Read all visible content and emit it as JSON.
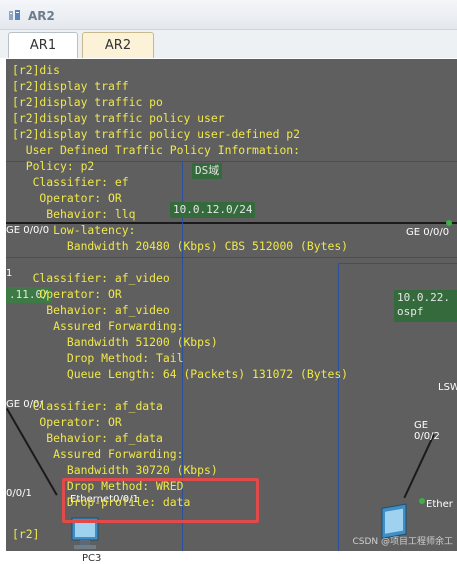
{
  "window": {
    "title": "AR2",
    "icon": "router-icon"
  },
  "tabs": [
    {
      "label": "AR1",
      "active": false
    },
    {
      "label": "AR2",
      "active": true
    }
  ],
  "terminal": {
    "text_color": "#f0e84a",
    "background": "#5f5f5f",
    "lines": [
      "[r2]dis",
      "[r2]display traff",
      "[r2]display traffic po",
      "[r2]display traffic policy user",
      "[r2]display traffic policy user-defined p2",
      "  User Defined Traffic Policy Information:",
      "  Policy: p2",
      "   Classifier: ef",
      "    Operator: OR",
      "     Behavior: llq",
      "      Low-latency:",
      "        Bandwidth 20480 (Kbps) CBS 512000 (Bytes)",
      "",
      "   Classifier: af_video",
      "    Operator: OR",
      "     Behavior: af_video",
      "      Assured Forwarding:",
      "        Bandwidth 51200 (Kbps)",
      "        Drop Method: Tail",
      "        Queue Length: 64 (Packets) 131072 (Bytes)",
      "",
      "   Classifier: af_data",
      "    Operator: OR",
      "     Behavior: af_data",
      "      Assured Forwarding:",
      "        Bandwidth 30720 (Kbps)",
      "        Drop Method: WRED",
      "        Drop-profile: data",
      "",
      "[r2]"
    ]
  },
  "background_topology": {
    "ds_domain": "DS域",
    "subnet_a": "10.0.12.0/24",
    "port_left": "GE 0/0/0",
    "port_right": "GE 0/0/0",
    "subnet_left_partial": ".11.0/",
    "subnet_right": "10.0.22.",
    "ospf": "ospf",
    "lsw": "LSW",
    "ge_left": "GE 0/0/",
    "ge_right": "GE 0/0/2",
    "left_edge_a": "1",
    "left_edge_b": "0/0/1",
    "ethernet_left": "Ethernet0/0/1",
    "ethernet_right": "Ether",
    "pc_label": "PC3"
  },
  "watermark": "CSDN @项目工程师余工"
}
